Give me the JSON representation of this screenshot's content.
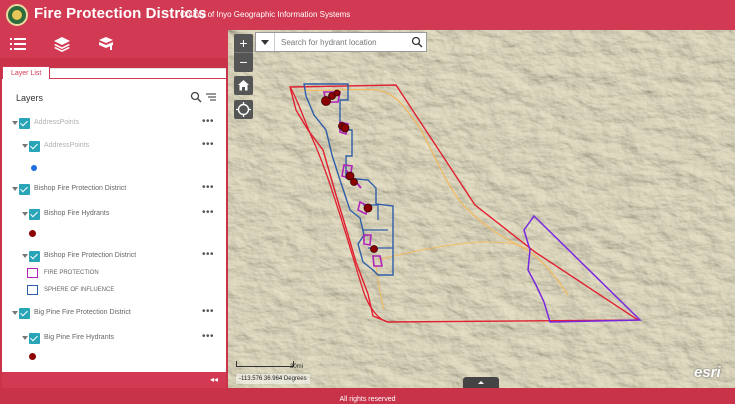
{
  "header": {
    "title": "Fire Protection Districts",
    "subtitle": "County of Inyo Geographic Information Systems"
  },
  "panel": {
    "tab_label": "Layer List",
    "heading": "Layers",
    "more_label": "•••",
    "layers": [
      {
        "label": "AddressPoints"
      },
      {
        "label": "AddressPoints"
      },
      {
        "label": "Bishop Fire Protection District"
      },
      {
        "label": "Bishop Fire Hydrants"
      },
      {
        "label": "Bishop Fire Protection District"
      },
      {
        "label": "Big Pine Fire Protection District"
      },
      {
        "label": "Big Pine Fire Hydrants"
      }
    ],
    "legend": {
      "fire_protection": "FIRE PROTECTION",
      "sphere": "SPHERE OF INFLUENCE"
    },
    "collapse_label": "◂◂"
  },
  "search": {
    "placeholder": "Search for hydrant location"
  },
  "map": {
    "zoom_in": "+",
    "zoom_out": "−",
    "scale_label": "30mi",
    "coordinates": "-113.576 36.964 Degrees",
    "esri_logo": "esri"
  },
  "footer": {
    "text": "All rights reserved"
  },
  "colors": {
    "brand": "#d13a52",
    "checkbox": "#2aa5b8",
    "hydrant": "#8b0000",
    "address_dot": "#1f6fe0",
    "fire_protection": "#b023b8",
    "sphere": "#2e5ea8",
    "boundary_red": "#e02030",
    "boundary_purple": "#7a28e0",
    "stream": "#f2b85a"
  }
}
